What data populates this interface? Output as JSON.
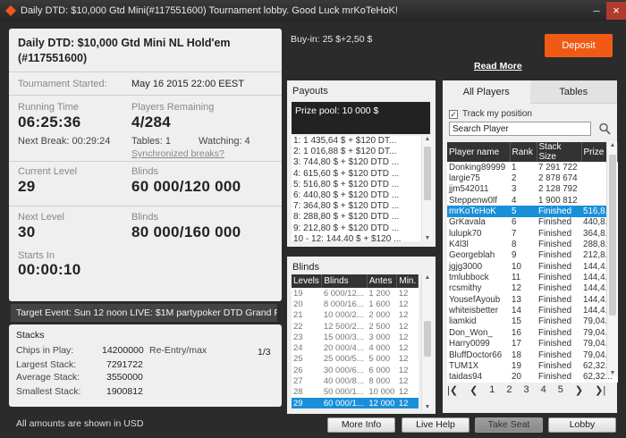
{
  "window": {
    "title": "Daily DTD: $10,000 Gtd Mini(#117551600) Tournament lobby. Good Luck mrKoTeHoK!"
  },
  "info": {
    "title": "Daily DTD: $10,000 Gtd Mini NL Hold'em (#117551600)",
    "started_label": "Tournament Started:",
    "started_value": "May 16 2015   22:00 EEST",
    "running_label": "Running Time",
    "running_value": "06:25:36",
    "players_label": "Players Remaining",
    "players_value": "4/284",
    "next_break": "Next Break: 00:29:24",
    "tables": "Tables: 1",
    "watching": "Watching: 4",
    "sync_breaks": "Synchronized breaks?",
    "current_level_label": "Current Level",
    "current_level": "29",
    "blinds_label": "Blinds",
    "current_blinds": "60 000/120 000",
    "next_level_label": "Next Level",
    "next_level": "30",
    "next_blinds_label": "Blinds",
    "next_blinds": "80 000/160 000",
    "starts_in_label": "Starts In",
    "starts_in": "00:00:10"
  },
  "target_event": "Target Event: Sun 12 noon LIVE: $1M partypoker DTD Grand Prix",
  "stacks": {
    "title": "Stacks",
    "chips_label": "Chips in Play:",
    "chips": "14200000",
    "largest_label": "Largest Stack:",
    "largest": "7291722",
    "average_label": "Average Stack:",
    "average": "3550000",
    "smallest_label": "Smallest Stack:",
    "smallest": "1900812",
    "reentry_label": "Re-Entry/max",
    "reentry": "1/3"
  },
  "footer_note": "All amounts are shown in USD",
  "buyin": "Buy-in: 25 $+2,50 $",
  "deposit_label": "Deposit",
  "read_more": "Read More",
  "payouts": {
    "title": "Payouts",
    "prize_pool": "Prize pool: 10 000 $",
    "rows": [
      "1: 1 435,64 $ + $120 DT...",
      "2: 1 016,88 $ + $120 DT...",
      "3: 744,80 $ + $120 DTD ...",
      "4: 615,60 $ + $120 DTD ...",
      "5: 516,80 $ + $120 DTD ...",
      "6: 440,80 $ + $120 DTD ...",
      "7: 364,80 $ + $120 DTD ...",
      "8: 288,80 $ + $120 DTD ...",
      "9: 212,80 $ + $120 DTD ...",
      "10 - 12: 144,40 $ + $120 ..."
    ]
  },
  "blinds": {
    "title": "Blinds",
    "headers": [
      "Levels",
      "Blinds",
      "Antes",
      "Min."
    ],
    "rows": [
      [
        "19",
        "6 000/12...",
        "1 200",
        "12"
      ],
      [
        "20",
        "8 000/16...",
        "1 600",
        "12"
      ],
      [
        "21",
        "10 000/2...",
        "2 000",
        "12"
      ],
      [
        "22",
        "12 500/2...",
        "2 500",
        "12"
      ],
      [
        "23",
        "15 000/3...",
        "3 000",
        "12"
      ],
      [
        "24",
        "20 000/4...",
        "4 000",
        "12"
      ],
      [
        "25",
        "25 000/5...",
        "5 000",
        "12"
      ],
      [
        "26",
        "30 000/6...",
        "6 000",
        "12"
      ],
      [
        "27",
        "40 000/8...",
        "8 000",
        "12"
      ],
      [
        "28",
        "50 000/1...",
        "10 000",
        "12"
      ],
      [
        "29",
        "60 000/1...",
        "12 000",
        "12"
      ]
    ],
    "current_index": 10
  },
  "players": {
    "tab_all": "All Players",
    "tab_tables": "Tables",
    "track_label": "Track my position",
    "search_value": "Search Player",
    "headers": [
      "Player name",
      "Rank",
      "Stack Size",
      "Prize"
    ],
    "rows": [
      [
        "Donking89999",
        "1",
        "7 291 722",
        ""
      ],
      [
        "largie75",
        "2",
        "2 878 674",
        ""
      ],
      [
        "jjm542011",
        "3",
        "2 128 792",
        ""
      ],
      [
        "Steppenw0lf",
        "4",
        "1 900 812",
        ""
      ],
      [
        "mrKoTeHoK",
        "5",
        "Finished",
        "516,8..."
      ],
      [
        "GrKavala",
        "6",
        "Finished",
        "440,8..."
      ],
      [
        "lulupk70",
        "7",
        "Finished",
        "364,8..."
      ],
      [
        "K4l3l",
        "8",
        "Finished",
        "288,8..."
      ],
      [
        "Georgeblah",
        "9",
        "Finished",
        "212,8..."
      ],
      [
        "jgjg3000",
        "10",
        "Finished",
        "144,4..."
      ],
      [
        "tmlubbock",
        "11",
        "Finished",
        "144,4..."
      ],
      [
        "rcsmithy",
        "12",
        "Finished",
        "144,4..."
      ],
      [
        "YousefAyoub",
        "13",
        "Finished",
        "144,4..."
      ],
      [
        "whiteisbetter",
        "14",
        "Finished",
        "144,4..."
      ],
      [
        "liamkid",
        "15",
        "Finished",
        "79,04..."
      ],
      [
        "Don_Won_",
        "16",
        "Finished",
        "79,04..."
      ],
      [
        "Harry0099",
        "17",
        "Finished",
        "79,04..."
      ],
      [
        "BluffDoctor66",
        "18",
        "Finished",
        "79,04..."
      ],
      [
        "TUM1X",
        "19",
        "Finished",
        "62,32..."
      ],
      [
        "taidas94",
        "20",
        "Finished",
        "62,32..."
      ]
    ],
    "current_index": 4,
    "pages": [
      "1",
      "2",
      "3",
      "4",
      "5"
    ]
  },
  "buttons": {
    "more_info": "More Info",
    "live_help": "Live Help",
    "take_seat": "Take Seat",
    "lobby": "Lobby"
  }
}
